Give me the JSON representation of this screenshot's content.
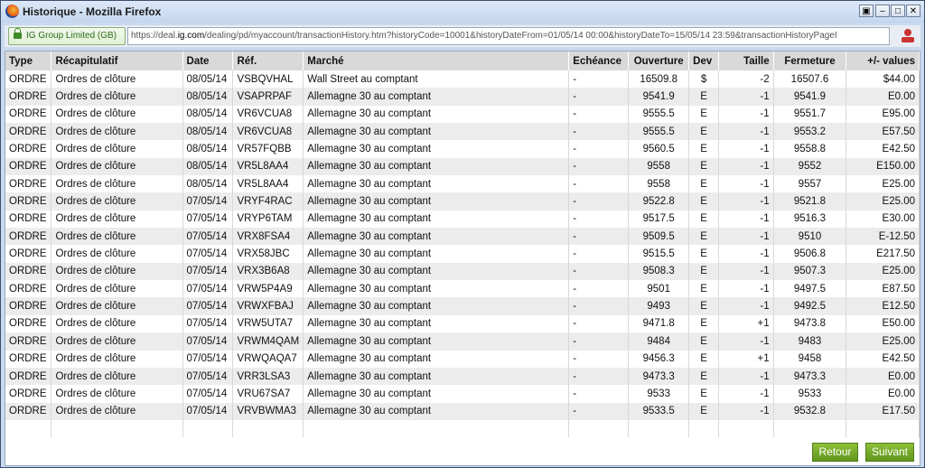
{
  "window": {
    "title": "Historique - Mozilla Firefox"
  },
  "urlbar": {
    "identity": "IG Group Limited (GB)",
    "url_prefix": "https://deal.",
    "url_domain": "ig.com",
    "url_rest": "/dealing/pd/myaccount/transactionHistory.htm?historyCode=10001&historyDateFrom=01/05/14 00:00&historyDateTo=15/05/14 23:59&transactionHistoryPageI"
  },
  "table": {
    "headers": [
      "Type",
      "Récapitulatif",
      "Date",
      "Réf.",
      "Marché",
      "Echéance",
      "Ouverture",
      "Dev",
      "Taille",
      "Fermeture",
      "+/- values"
    ],
    "rows": [
      [
        "ORDRE",
        "Ordres de clôture",
        "08/05/14",
        "VSBQVHAL",
        "Wall Street au comptant",
        "-",
        "16509.8",
        "$",
        "-2",
        "16507.6",
        "$44.00"
      ],
      [
        "ORDRE",
        "Ordres de clôture",
        "08/05/14",
        "VSAPRPAF",
        "Allemagne 30 au comptant",
        "-",
        "9541.9",
        "E",
        "-1",
        "9541.9",
        "E0.00"
      ],
      [
        "ORDRE",
        "Ordres de clôture",
        "08/05/14",
        "VR6VCUA8",
        "Allemagne 30 au comptant",
        "-",
        "9555.5",
        "E",
        "-1",
        "9551.7",
        "E95.00"
      ],
      [
        "ORDRE",
        "Ordres de clôture",
        "08/05/14",
        "VR6VCUA8",
        "Allemagne 30 au comptant",
        "-",
        "9555.5",
        "E",
        "-1",
        "9553.2",
        "E57.50"
      ],
      [
        "ORDRE",
        "Ordres de clôture",
        "08/05/14",
        "VR57FQBB",
        "Allemagne 30 au comptant",
        "-",
        "9560.5",
        "E",
        "-1",
        "9558.8",
        "E42.50"
      ],
      [
        "ORDRE",
        "Ordres de clôture",
        "08/05/14",
        "VR5L8AA4",
        "Allemagne 30 au comptant",
        "-",
        "9558",
        "E",
        "-1",
        "9552",
        "E150.00"
      ],
      [
        "ORDRE",
        "Ordres de clôture",
        "08/05/14",
        "VR5L8AA4",
        "Allemagne 30 au comptant",
        "-",
        "9558",
        "E",
        "-1",
        "9557",
        "E25.00"
      ],
      [
        "ORDRE",
        "Ordres de clôture",
        "07/05/14",
        "VRYF4RAC",
        "Allemagne 30 au comptant",
        "-",
        "9522.8",
        "E",
        "-1",
        "9521.8",
        "E25.00"
      ],
      [
        "ORDRE",
        "Ordres de clôture",
        "07/05/14",
        "VRYP6TAM",
        "Allemagne 30 au comptant",
        "-",
        "9517.5",
        "E",
        "-1",
        "9516.3",
        "E30.00"
      ],
      [
        "ORDRE",
        "Ordres de clôture",
        "07/05/14",
        "VRX8FSA4",
        "Allemagne 30 au comptant",
        "-",
        "9509.5",
        "E",
        "-1",
        "9510",
        "E-12.50"
      ],
      [
        "ORDRE",
        "Ordres de clôture",
        "07/05/14",
        "VRX58JBC",
        "Allemagne 30 au comptant",
        "-",
        "9515.5",
        "E",
        "-1",
        "9506.8",
        "E217.50"
      ],
      [
        "ORDRE",
        "Ordres de clôture",
        "07/05/14",
        "VRX3B6A8",
        "Allemagne 30 au comptant",
        "-",
        "9508.3",
        "E",
        "-1",
        "9507.3",
        "E25.00"
      ],
      [
        "ORDRE",
        "Ordres de clôture",
        "07/05/14",
        "VRW5P4A9",
        "Allemagne 30 au comptant",
        "-",
        "9501",
        "E",
        "-1",
        "9497.5",
        "E87.50"
      ],
      [
        "ORDRE",
        "Ordres de clôture",
        "07/05/14",
        "VRWXFBAJ",
        "Allemagne 30 au comptant",
        "-",
        "9493",
        "E",
        "-1",
        "9492.5",
        "E12.50"
      ],
      [
        "ORDRE",
        "Ordres de clôture",
        "07/05/14",
        "VRW5UTA7",
        "Allemagne 30 au comptant",
        "-",
        "9471.8",
        "E",
        "+1",
        "9473.8",
        "E50.00"
      ],
      [
        "ORDRE",
        "Ordres de clôture",
        "07/05/14",
        "VRWM4QAM",
        "Allemagne 30 au comptant",
        "-",
        "9484",
        "E",
        "-1",
        "9483",
        "E25.00"
      ],
      [
        "ORDRE",
        "Ordres de clôture",
        "07/05/14",
        "VRWQAQA7",
        "Allemagne 30 au comptant",
        "-",
        "9456.3",
        "E",
        "+1",
        "9458",
        "E42.50"
      ],
      [
        "ORDRE",
        "Ordres de clôture",
        "07/05/14",
        "VRR3LSA3",
        "Allemagne 30 au comptant",
        "-",
        "9473.3",
        "E",
        "-1",
        "9473.3",
        "E0.00"
      ],
      [
        "ORDRE",
        "Ordres de clôture",
        "07/05/14",
        "VRU67SA7",
        "Allemagne 30 au comptant",
        "-",
        "9533",
        "E",
        "-1",
        "9533",
        "E0.00"
      ],
      [
        "ORDRE",
        "Ordres de clôture",
        "07/05/14",
        "VRVBWMA3",
        "Allemagne 30 au comptant",
        "-",
        "9533.5",
        "E",
        "-1",
        "9532.8",
        "E17.50"
      ]
    ]
  },
  "buttons": {
    "back": "Retour",
    "next": "Suivant"
  }
}
